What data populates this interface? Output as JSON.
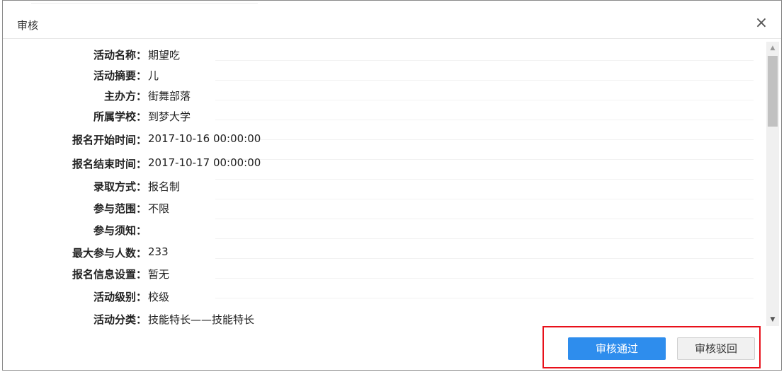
{
  "dialog": {
    "title": "审核",
    "close_symbol": "×"
  },
  "fields": [
    {
      "label": "活动名称：",
      "value": "期望吃"
    },
    {
      "label": "活动摘要：",
      "value": "儿"
    },
    {
      "label": "主办方：",
      "value": "街舞部落"
    },
    {
      "label": "所属学校：",
      "value": "到梦大学"
    },
    {
      "label": "报名开始时间：",
      "value": "2017-10-16 00:00:00"
    },
    {
      "label": "报名结束时间：",
      "value": "2017-10-17 00:00:00"
    },
    {
      "label": "录取方式：",
      "value": "报名制"
    },
    {
      "label": "参与范围：",
      "value": "不限"
    },
    {
      "label": "参与须知：",
      "value": ""
    },
    {
      "label": "最大参与人数：",
      "value": "233"
    },
    {
      "label": "报名信息设置：",
      "value": "暂无"
    },
    {
      "label": "活动级别：",
      "value": "校级"
    },
    {
      "label": "活动分类：",
      "value": "技能特长——技能特长"
    }
  ],
  "buttons": {
    "approve_label": "审核通过",
    "reject_label": "审核驳回"
  },
  "colors": {
    "primary": "#2e8ded",
    "highlight": "#e8101a"
  }
}
